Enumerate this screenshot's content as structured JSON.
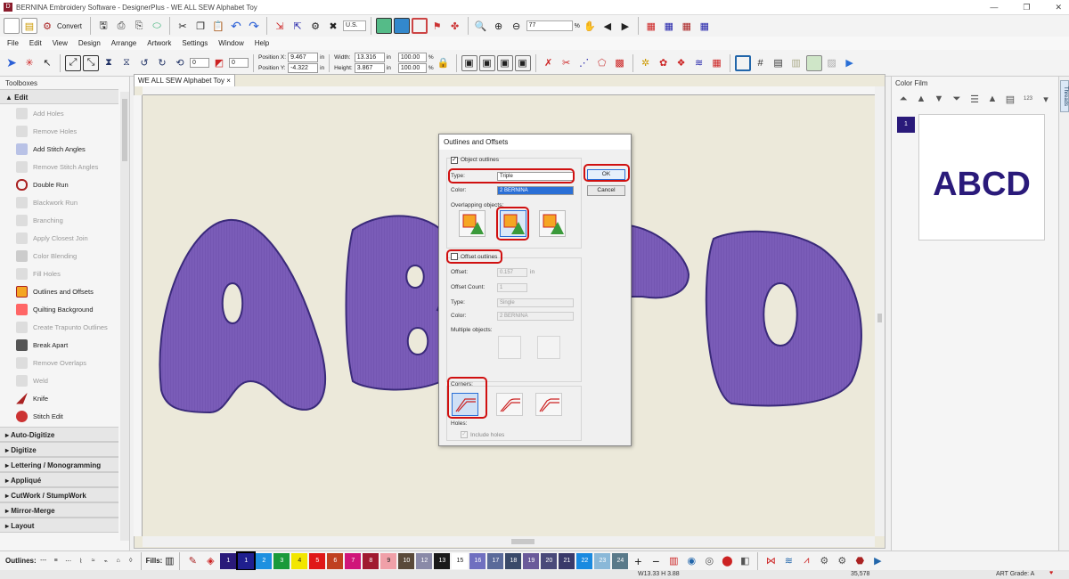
{
  "window": {
    "title": "BERNINA Embroidery Software - DesignerPlus - WE ALL SEW Alphabet Toy",
    "min": "—",
    "restore": "❐",
    "close": "✕"
  },
  "toolbar1": {
    "convert_label": "Convert",
    "units": "U.S.",
    "zoom_value": "77",
    "zoom_unit": "%"
  },
  "menu": [
    "File",
    "Edit",
    "View",
    "Design",
    "Arrange",
    "Artwork",
    "Settings",
    "Window",
    "Help"
  ],
  "toolbar2": {
    "rotate_value": "0",
    "slant_value": "0",
    "pos_x_label": "Position X:",
    "pos_x": "9.467",
    "pos_x_unit": "in",
    "pos_y_label": "Position Y:",
    "pos_y": "-4.322",
    "pos_y_unit": "in",
    "width_label": "Width:",
    "width": "13.316",
    "width_unit": "in",
    "height_label": "Height:",
    "height": "3.867",
    "height_unit": "in",
    "scale_x": "100.00",
    "scale_y": "100.00",
    "pct": "%"
  },
  "toolboxes": {
    "title": "Toolboxes",
    "edit_group": "Edit",
    "items": [
      {
        "label": "Add Holes",
        "enabled": false
      },
      {
        "label": "Remove Holes",
        "enabled": false
      },
      {
        "label": "Add Stitch Angles",
        "enabled": true
      },
      {
        "label": "Remove Stitch Angles",
        "enabled": false
      },
      {
        "label": "Double Run",
        "enabled": true
      },
      {
        "label": "Blackwork Run",
        "enabled": false
      },
      {
        "label": "Branching",
        "enabled": false
      },
      {
        "label": "Apply Closest Join",
        "enabled": false
      },
      {
        "label": "Color Blending",
        "enabled": false
      },
      {
        "label": "Fill Holes",
        "enabled": false
      },
      {
        "label": "Outlines and Offsets",
        "enabled": true
      },
      {
        "label": "Quilting Background",
        "enabled": true
      },
      {
        "label": "Create Trapunto Outlines",
        "enabled": false
      },
      {
        "label": "Break Apart",
        "enabled": true
      },
      {
        "label": "Remove Overlaps",
        "enabled": false
      },
      {
        "label": "Weld",
        "enabled": false
      },
      {
        "label": "Knife",
        "enabled": true
      },
      {
        "label": "Stitch Edit",
        "enabled": true
      }
    ],
    "groups": [
      "Auto-Digitize",
      "Digitize",
      "Lettering / Monogramming",
      "Appliqué",
      "CutWork / StumpWork",
      "Mirror-Merge",
      "Layout"
    ]
  },
  "document": {
    "tab_label": "WE ALL SEW Alphabet Toy",
    "tab_close": "×",
    "letters": [
      "A",
      "B",
      "C",
      "D"
    ]
  },
  "dialog": {
    "title": "Outlines and Offsets",
    "object_outlines_label": "Object outlines",
    "object_outlines_checked": true,
    "type_label": "Type:",
    "type_value": "Triple",
    "color_label": "Color:",
    "color_value": "2 BERNINA",
    "overlapping_label": "Overlapping objects:",
    "ok_label": "OK",
    "cancel_label": "Cancel",
    "offset_outlines_label": "Offset outlines",
    "offset_outlines_checked": false,
    "offset_label": "Offset:",
    "offset_value": "0.157",
    "offset_unit": "in",
    "offset_count_label": "Offset Count:",
    "offset_count_value": "1",
    "offset_type_label": "Type:",
    "offset_type_value": "Single",
    "offset_color_label": "Color:",
    "offset_color_value": "2 BERNINA",
    "multiple_label": "Multiple objects:",
    "corners_label": "Corners:",
    "holes_label": "Holes:",
    "include_holes_label": "Include holes"
  },
  "color_film": {
    "title": "Color Film",
    "side_tab": "Threads",
    "item_number": "1",
    "preview_text": "ABCD",
    "sort_label": "123"
  },
  "bottom": {
    "outlines_label": "Outlines:",
    "fills_label": "Fills:",
    "swatches": [
      {
        "n": "1",
        "c": "#2a1a7a"
      },
      {
        "n": "1",
        "c": "#1f1f8f"
      },
      {
        "n": "2",
        "c": "#1e90e0"
      },
      {
        "n": "3",
        "c": "#1a9a3a"
      },
      {
        "n": "4",
        "c": "#f2e600"
      },
      {
        "n": "5",
        "c": "#e01818"
      },
      {
        "n": "6",
        "c": "#c04020"
      },
      {
        "n": "7",
        "c": "#d0157a"
      },
      {
        "n": "8",
        "c": "#a01a30"
      },
      {
        "n": "9",
        "c": "#f0a0a8"
      },
      {
        "n": "10",
        "c": "#5a4a3a"
      },
      {
        "n": "12",
        "c": "#8a8aa8"
      },
      {
        "n": "13",
        "c": "#1a1a1a"
      },
      {
        "n": "15",
        "c": "#ffffff"
      },
      {
        "n": "16",
        "c": "#7070c0"
      },
      {
        "n": "17",
        "c": "#5a6a9a"
      },
      {
        "n": "18",
        "c": "#3a4a6a"
      },
      {
        "n": "19",
        "c": "#6a5a9a"
      },
      {
        "n": "20",
        "c": "#4a4a7a"
      },
      {
        "n": "21",
        "c": "#3a3a6a"
      },
      {
        "n": "22",
        "c": "#1a8ae0"
      },
      {
        "n": "23",
        "c": "#8ab8d8"
      },
      {
        "n": "24",
        "c": "#5a7a8a"
      }
    ]
  },
  "status": {
    "dimensions": "W13.33 H 3.88",
    "count": "35,578",
    "art_grade": "ART Grade: A"
  },
  "colors": {
    "accent": "#2a6fd6",
    "highlight": "#d01010",
    "stitch_fill": "#7a5cb8",
    "stitch_edge": "#3a2a7a"
  }
}
